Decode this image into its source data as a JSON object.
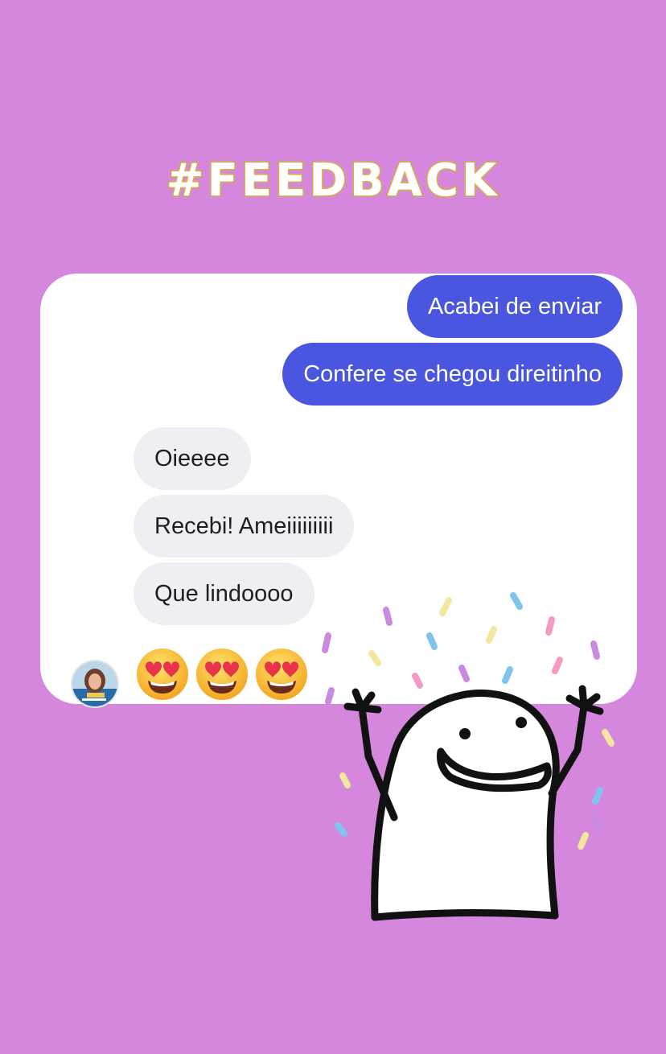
{
  "header": {
    "title": "#FEEDBACK"
  },
  "colors": {
    "background": "#d587de",
    "sent_bubble": "#4a55e0",
    "received_bubble": "#efeef2",
    "title_outline": "#c9a33a"
  },
  "messages": {
    "sent": [
      "Acabei de enviar",
      "Confere se chegou direitinho"
    ],
    "received": [
      "Oieeee",
      "Recebi! Ameiiiiiiiii",
      "Que lindoooo"
    ]
  },
  "reaction": {
    "icon": "heart-eyes-emoji",
    "count": 3
  },
  "decoration": {
    "icon": "flork-celebrating-sticker"
  }
}
